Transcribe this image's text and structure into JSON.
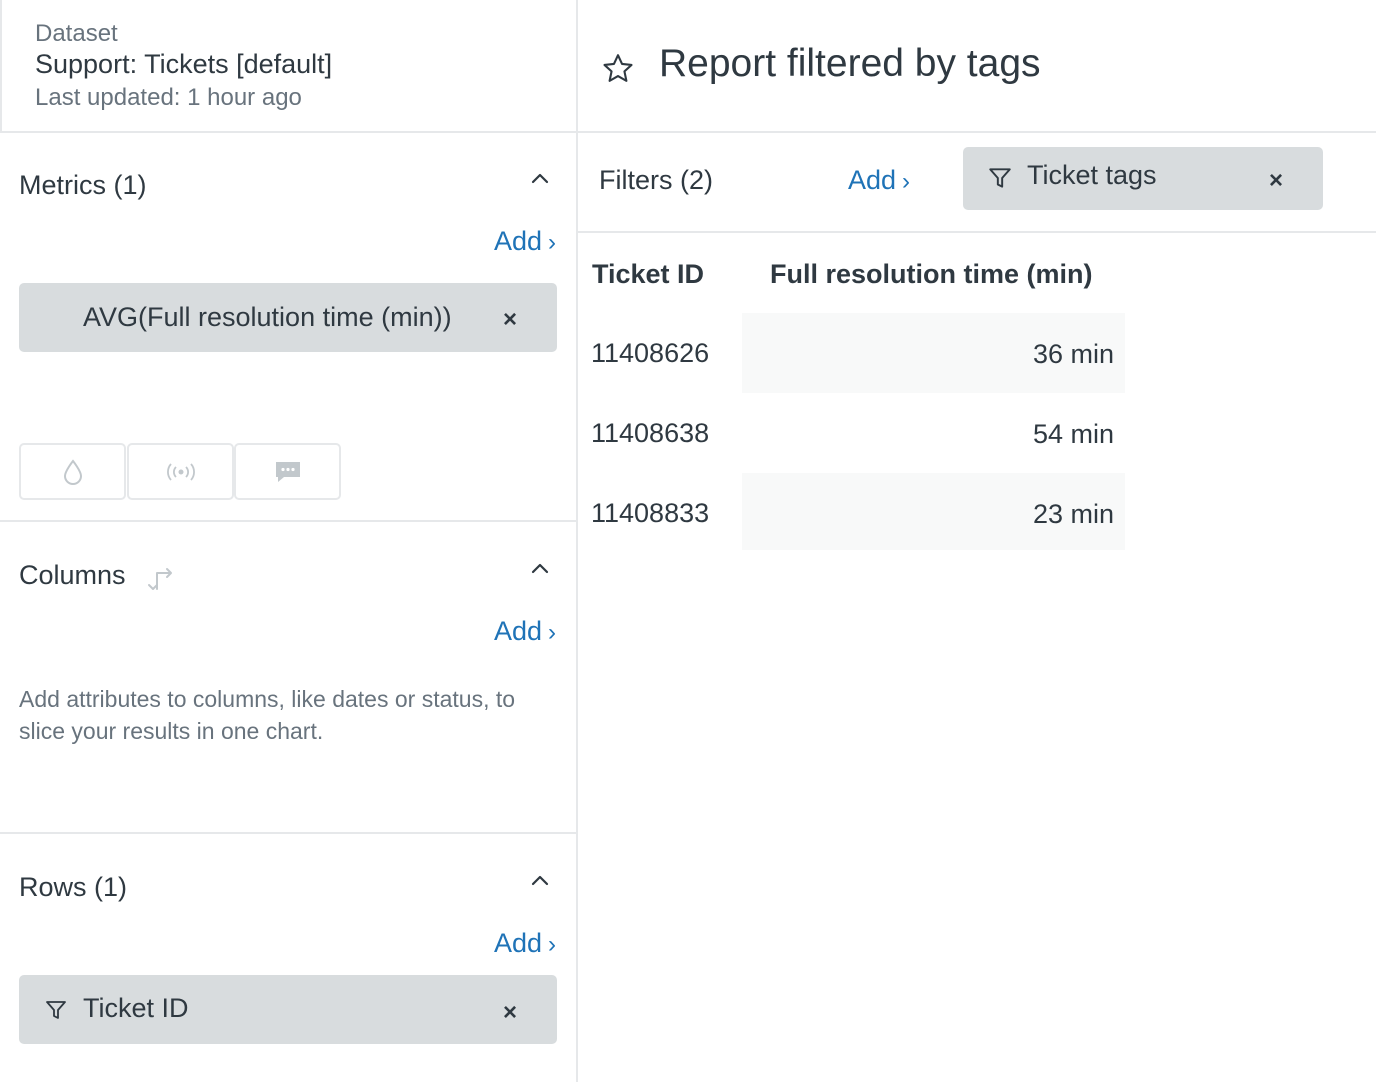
{
  "dataset": {
    "label": "Dataset",
    "name": "Support: Tickets [default]",
    "updated": "Last updated: 1 hour ago"
  },
  "metrics": {
    "title": "Metrics (1)",
    "add": "Add",
    "items": [
      {
        "label": "AVG(Full resolution time (min))"
      }
    ],
    "remove_glyph": "×",
    "viz_buttons": [
      "droplet-icon",
      "broadcast-icon",
      "speech-bubble-icon"
    ]
  },
  "columns": {
    "title": "Columns",
    "add": "Add",
    "help": "Add attributes to columns, like dates or status, to slice your results in one chart."
  },
  "rows": {
    "title": "Rows (1)",
    "add": "Add",
    "items": [
      {
        "label": "Ticket ID"
      }
    ],
    "remove_glyph": "×"
  },
  "report": {
    "title": "Report filtered by tags"
  },
  "filters": {
    "label": "Filters (2)",
    "add": "Add",
    "items": [
      {
        "label": "Ticket tags"
      }
    ],
    "remove_glyph": "×"
  },
  "table": {
    "headers": [
      "Ticket ID",
      "Full resolution time (min)"
    ],
    "rows": [
      {
        "id": "11408626",
        "value": "36 min"
      },
      {
        "id": "11408638",
        "value": "54 min"
      },
      {
        "id": "11408833",
        "value": "23 min"
      }
    ]
  },
  "colors": {
    "accent": "#1f73b7",
    "pill": "#d8dcde",
    "text": "#2f3941",
    "muted": "#68737d",
    "border": "#e6e8ea"
  }
}
